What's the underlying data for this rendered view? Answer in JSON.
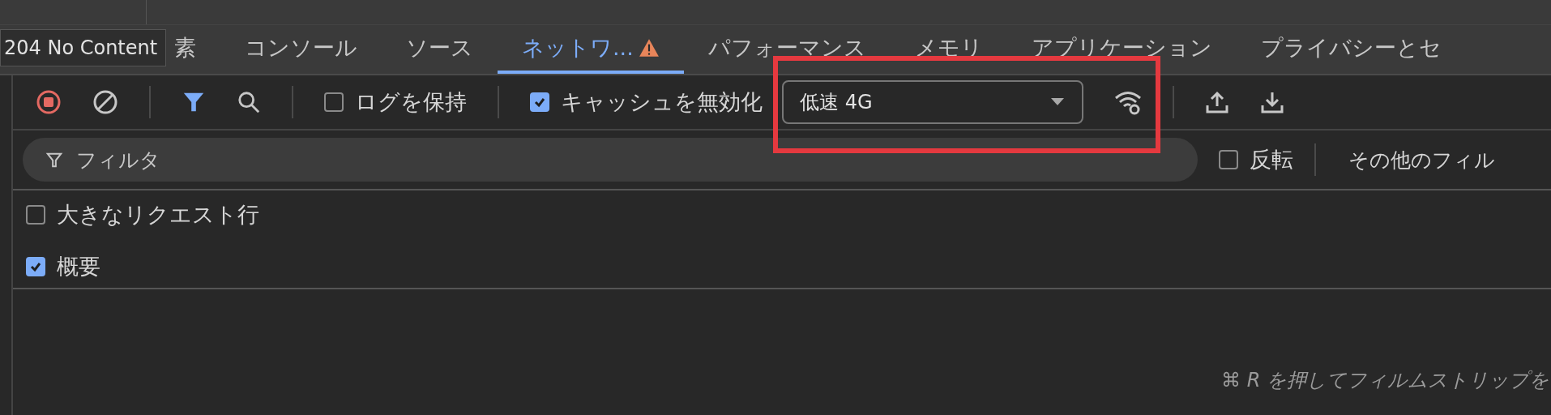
{
  "tooltip": {
    "text": "204 No Content"
  },
  "tabs": [
    {
      "label": "素",
      "selected": false,
      "warning": false
    },
    {
      "label": "コンソール",
      "selected": false,
      "warning": false
    },
    {
      "label": "ソース",
      "selected": false,
      "warning": false
    },
    {
      "label": "ネットワ...",
      "selected": true,
      "warning": true
    },
    {
      "label": "パフォーマンス",
      "selected": false,
      "warning": false
    },
    {
      "label": "メモリ",
      "selected": false,
      "warning": false
    },
    {
      "label": "アプリケーション",
      "selected": false,
      "warning": false
    },
    {
      "label": "プライバシーとセ",
      "selected": false,
      "warning": false
    }
  ],
  "toolbar": {
    "recording": true,
    "filter_active": true,
    "preserve_log": {
      "label": "ログを保持",
      "checked": false
    },
    "disable_cache": {
      "label": "キャッシュを無効化",
      "checked": true
    },
    "throttling": {
      "value": "低速 4G",
      "highlighted": true
    }
  },
  "filter_bar": {
    "placeholder": "フィルタ",
    "invert": {
      "label": "反転",
      "checked": false
    },
    "more_filters": "その他のフィル"
  },
  "options": [
    {
      "label": "大きなリクエスト行",
      "checked": false
    },
    {
      "label": "概要",
      "checked": true
    }
  ],
  "hint": "⌘ R を押してフィルムストリップを"
}
